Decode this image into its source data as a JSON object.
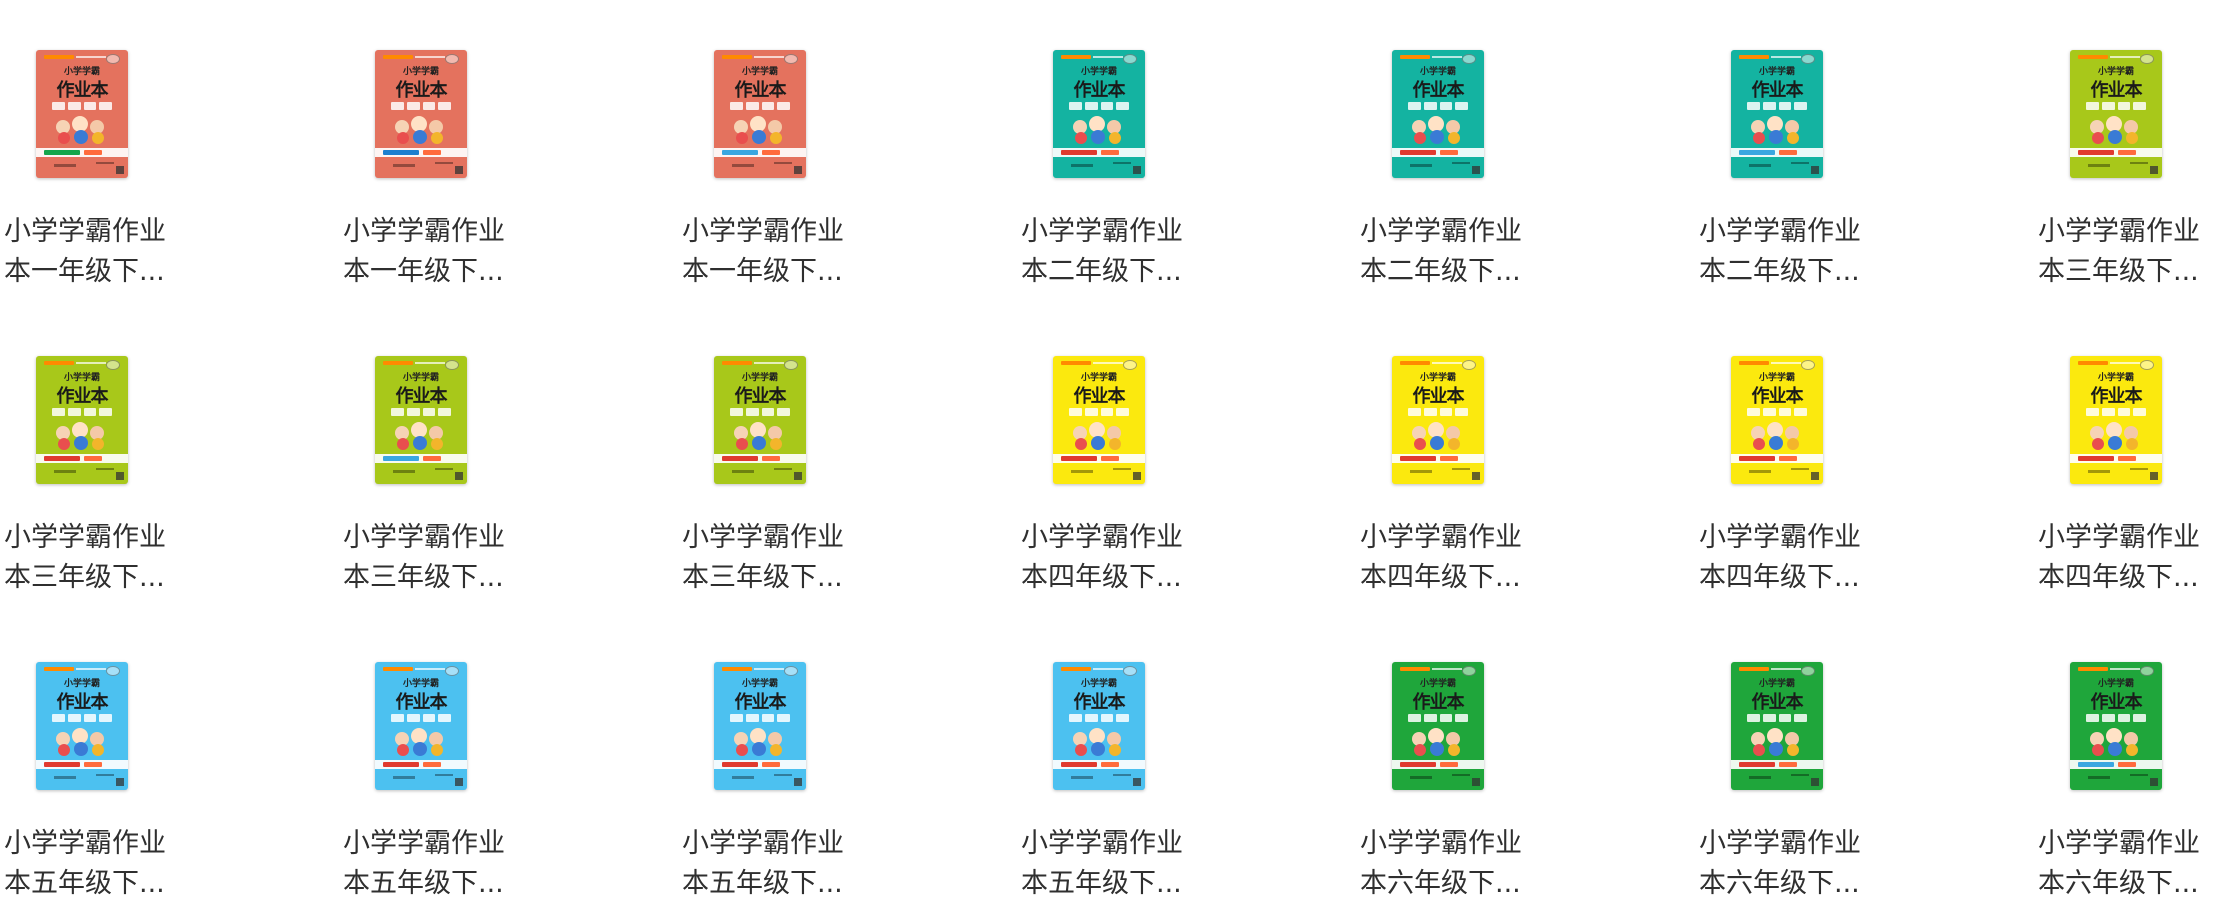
{
  "files": [
    {
      "name": "小学学霸作业\n本一年级下...",
      "cover": {
        "color": "#e4725e",
        "stripe": "#15a64c",
        "title_small": "小学学霸",
        "title_big": "作业本"
      }
    },
    {
      "name": "小学学霸作业\n本一年级下...",
      "cover": {
        "color": "#e4725e",
        "stripe": "#1c7fcf",
        "title_small": "小学学霸",
        "title_big": "作业本"
      }
    },
    {
      "name": "小学学霸作业\n本一年级下...",
      "cover": {
        "color": "#e4725e",
        "stripe": "#3aa7e0",
        "title_small": "小学学霸",
        "title_big": "作业本"
      }
    },
    {
      "name": "小学学霸作业\n本二年级下...",
      "cover": {
        "color": "#14b3a1",
        "stripe": "#e03a2f",
        "title_small": "小学学霸",
        "title_big": "作业本"
      }
    },
    {
      "name": "小学学霸作业\n本二年级下...",
      "cover": {
        "color": "#14b3a1",
        "stripe": "#e03a2f",
        "title_small": "小学学霸",
        "title_big": "作业本"
      }
    },
    {
      "name": "小学学霸作业\n本二年级下...",
      "cover": {
        "color": "#14b3a1",
        "stripe": "#3aa7e0",
        "title_small": "小学学霸",
        "title_big": "作业本"
      }
    },
    {
      "name": "小学学霸作业\n本三年级下...",
      "cover": {
        "color": "#a8c81a",
        "stripe": "#e03a2f",
        "title_small": "小学学霸",
        "title_big": "作业本"
      }
    },
    {
      "name": "小学学霸作业\n本三年级下...",
      "cover": {
        "color": "#a8c81a",
        "stripe": "#e03a2f",
        "title_small": "小学学霸",
        "title_big": "作业本"
      }
    },
    {
      "name": "小学学霸作业\n本三年级下...",
      "cover": {
        "color": "#a8c81a",
        "stripe": "#3aa7e0",
        "title_small": "小学学霸",
        "title_big": "作业本"
      }
    },
    {
      "name": "小学学霸作业\n本三年级下...",
      "cover": {
        "color": "#a8c81a",
        "stripe": "#e03a2f",
        "title_small": "小学学霸",
        "title_big": "作业本"
      }
    },
    {
      "name": "小学学霸作业\n本四年级下...",
      "cover": {
        "color": "#fbe90e",
        "stripe": "#e03a2f",
        "title_small": "小学学霸",
        "title_big": "作业本"
      }
    },
    {
      "name": "小学学霸作业\n本四年级下...",
      "cover": {
        "color": "#fbe90e",
        "stripe": "#e03a2f",
        "title_small": "小学学霸",
        "title_big": "作业本"
      }
    },
    {
      "name": "小学学霸作业\n本四年级下...",
      "cover": {
        "color": "#fbe90e",
        "stripe": "#e03a2f",
        "title_small": "小学学霸",
        "title_big": "作业本"
      }
    },
    {
      "name": "小学学霸作业\n本四年级下...",
      "cover": {
        "color": "#fbe90e",
        "stripe": "#e03a2f",
        "title_small": "小学学霸",
        "title_big": "作业本"
      }
    },
    {
      "name": "小学学霸作业\n本五年级下...",
      "cover": {
        "color": "#4cc1f0",
        "stripe": "#e03a2f",
        "title_small": "小学学霸",
        "title_big": "作业本"
      }
    },
    {
      "name": "小学学霸作业\n本五年级下...",
      "cover": {
        "color": "#4cc1f0",
        "stripe": "#e03a2f",
        "title_small": "小学学霸",
        "title_big": "作业本"
      }
    },
    {
      "name": "小学学霸作业\n本五年级下...",
      "cover": {
        "color": "#4cc1f0",
        "stripe": "#e03a2f",
        "title_small": "小学学霸",
        "title_big": "作业本"
      }
    },
    {
      "name": "小学学霸作业\n本五年级下...",
      "cover": {
        "color": "#4cc1f0",
        "stripe": "#e03a2f",
        "title_small": "小学学霸",
        "title_big": "作业本"
      }
    },
    {
      "name": "小学学霸作业\n本六年级下...",
      "cover": {
        "color": "#1fa63b",
        "stripe": "#e03a2f",
        "title_small": "小学学霸",
        "title_big": "作业本"
      }
    },
    {
      "name": "小学学霸作业\n本六年级下...",
      "cover": {
        "color": "#1fa63b",
        "stripe": "#e03a2f",
        "title_small": "小学学霸",
        "title_big": "作业本"
      }
    },
    {
      "name": "小学学霸作业\n本六年级下...",
      "cover": {
        "color": "#1fa63b",
        "stripe": "#3aa7e0",
        "title_small": "小学学霸",
        "title_big": "作业本"
      }
    }
  ]
}
